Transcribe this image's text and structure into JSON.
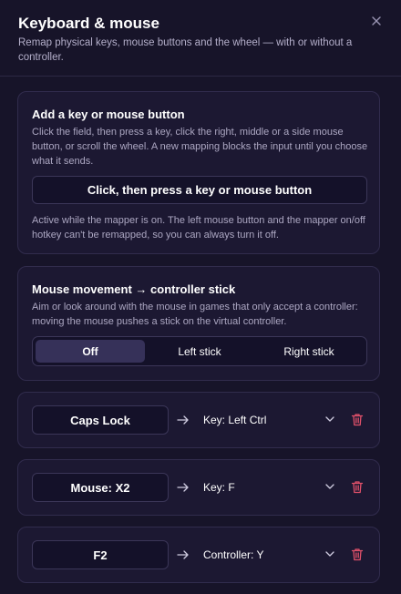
{
  "header": {
    "title": "Keyboard & mouse",
    "subtitle": "Remap physical keys, mouse buttons and the wheel — with or without a controller.",
    "close_icon": "close-icon"
  },
  "add_card": {
    "title": "Add a key or mouse button",
    "description": "Click the field, then press a key, click the right, middle or a side mouse button, or scroll the wheel. A new mapping blocks the input until you choose what it sends.",
    "capture_label": "Click, then press a key or mouse button",
    "note": "Active while the mapper is on. The left mouse button and the mapper on/off hotkey can't be remapped, so you can always turn it off."
  },
  "mouse_card": {
    "title": "Mouse movement → controller stick",
    "description": "Aim or look around with the mouse in games that only accept a controller: moving the mouse pushes a stick on the virtual controller.",
    "options": [
      "Off",
      "Left stick",
      "Right stick"
    ],
    "selected": "Off"
  },
  "mappings": [
    {
      "source": "Caps Lock",
      "target": "Key: Left Ctrl"
    },
    {
      "source": "Mouse: X2",
      "target": "Key: F"
    },
    {
      "source": "F2",
      "target": "Controller: Y"
    }
  ],
  "colors": {
    "background": "#171429",
    "card": "#1c1832",
    "accent_selected": "#363159",
    "delete": "#e0506a"
  }
}
